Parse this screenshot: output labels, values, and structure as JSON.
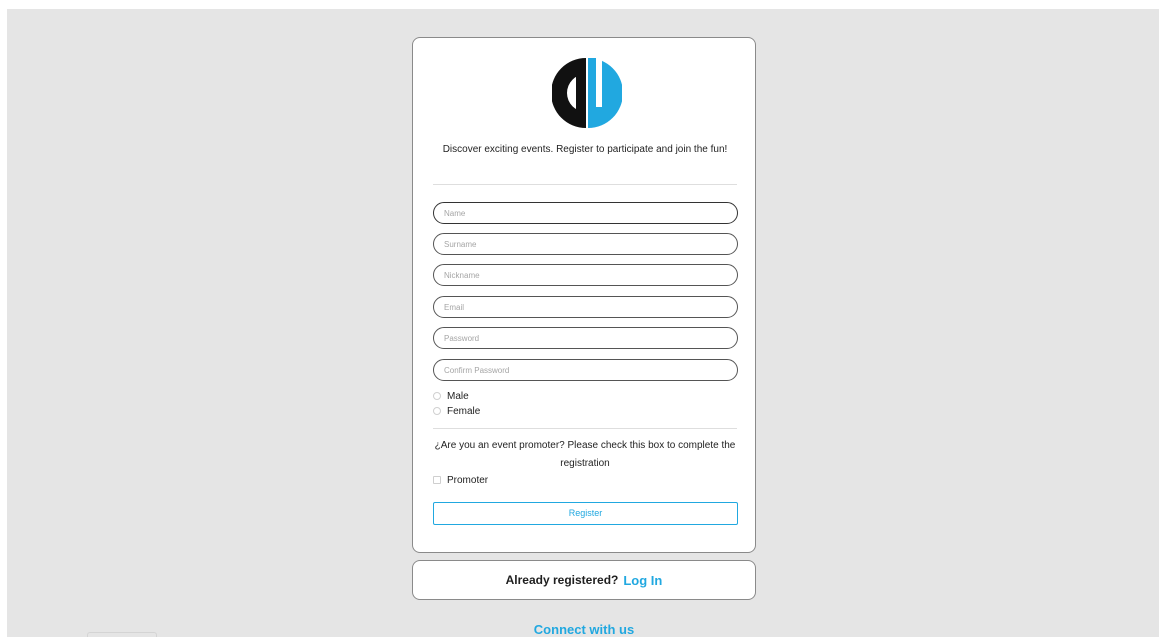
{
  "brand": {
    "logo_icon": "cu-logo-icon",
    "colors": {
      "black": "#111111",
      "blue": "#21a8e0"
    }
  },
  "tagline": "Discover exciting events. Register to participate and join the fun!",
  "form": {
    "name_placeholder": "Name",
    "surname_placeholder": "Surname",
    "nickname_placeholder": "Nickname",
    "email_placeholder": "Email",
    "password_placeholder": "Password",
    "confirm_password_placeholder": "Confirm Password",
    "gender_options": [
      "Male",
      "Female"
    ],
    "promoter_question": "¿Are you an event promoter? Please check this box to complete the registration",
    "promoter_label": "Promoter",
    "register_label": "Register"
  },
  "login": {
    "prompt": "Already registered?",
    "link": "Log In"
  },
  "footer": {
    "connect": "Connect with us"
  },
  "accent_color": "#21a8e0"
}
